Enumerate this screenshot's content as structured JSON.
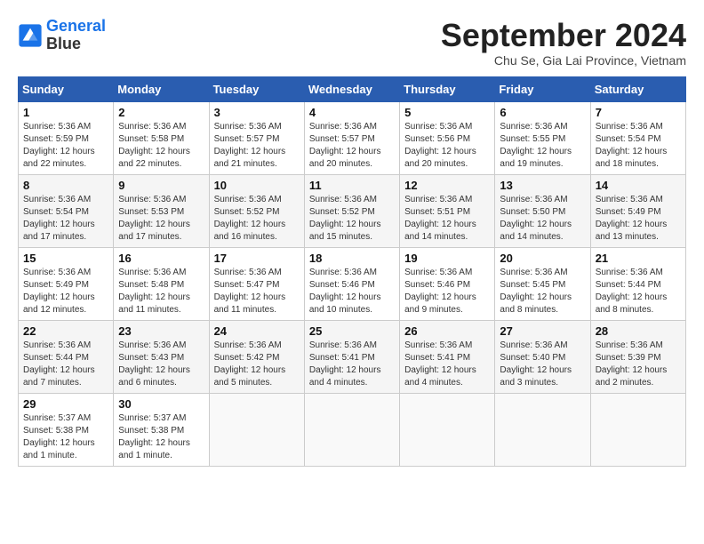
{
  "header": {
    "logo_line1": "General",
    "logo_line2": "Blue",
    "month_title": "September 2024",
    "subtitle": "Chu Se, Gia Lai Province, Vietnam"
  },
  "weekdays": [
    "Sunday",
    "Monday",
    "Tuesday",
    "Wednesday",
    "Thursday",
    "Friday",
    "Saturday"
  ],
  "weeks": [
    [
      {
        "day": "1",
        "sunrise": "5:36 AM",
        "sunset": "5:59 PM",
        "daylight": "12 hours and 22 minutes."
      },
      {
        "day": "2",
        "sunrise": "5:36 AM",
        "sunset": "5:58 PM",
        "daylight": "12 hours and 22 minutes."
      },
      {
        "day": "3",
        "sunrise": "5:36 AM",
        "sunset": "5:57 PM",
        "daylight": "12 hours and 21 minutes."
      },
      {
        "day": "4",
        "sunrise": "5:36 AM",
        "sunset": "5:57 PM",
        "daylight": "12 hours and 20 minutes."
      },
      {
        "day": "5",
        "sunrise": "5:36 AM",
        "sunset": "5:56 PM",
        "daylight": "12 hours and 20 minutes."
      },
      {
        "day": "6",
        "sunrise": "5:36 AM",
        "sunset": "5:55 PM",
        "daylight": "12 hours and 19 minutes."
      },
      {
        "day": "7",
        "sunrise": "5:36 AM",
        "sunset": "5:54 PM",
        "daylight": "12 hours and 18 minutes."
      }
    ],
    [
      {
        "day": "8",
        "sunrise": "5:36 AM",
        "sunset": "5:54 PM",
        "daylight": "12 hours and 17 minutes."
      },
      {
        "day": "9",
        "sunrise": "5:36 AM",
        "sunset": "5:53 PM",
        "daylight": "12 hours and 17 minutes."
      },
      {
        "day": "10",
        "sunrise": "5:36 AM",
        "sunset": "5:52 PM",
        "daylight": "12 hours and 16 minutes."
      },
      {
        "day": "11",
        "sunrise": "5:36 AM",
        "sunset": "5:52 PM",
        "daylight": "12 hours and 15 minutes."
      },
      {
        "day": "12",
        "sunrise": "5:36 AM",
        "sunset": "5:51 PM",
        "daylight": "12 hours and 14 minutes."
      },
      {
        "day": "13",
        "sunrise": "5:36 AM",
        "sunset": "5:50 PM",
        "daylight": "12 hours and 14 minutes."
      },
      {
        "day": "14",
        "sunrise": "5:36 AM",
        "sunset": "5:49 PM",
        "daylight": "12 hours and 13 minutes."
      }
    ],
    [
      {
        "day": "15",
        "sunrise": "5:36 AM",
        "sunset": "5:49 PM",
        "daylight": "12 hours and 12 minutes."
      },
      {
        "day": "16",
        "sunrise": "5:36 AM",
        "sunset": "5:48 PM",
        "daylight": "12 hours and 11 minutes."
      },
      {
        "day": "17",
        "sunrise": "5:36 AM",
        "sunset": "5:47 PM",
        "daylight": "12 hours and 11 minutes."
      },
      {
        "day": "18",
        "sunrise": "5:36 AM",
        "sunset": "5:46 PM",
        "daylight": "12 hours and 10 minutes."
      },
      {
        "day": "19",
        "sunrise": "5:36 AM",
        "sunset": "5:46 PM",
        "daylight": "12 hours and 9 minutes."
      },
      {
        "day": "20",
        "sunrise": "5:36 AM",
        "sunset": "5:45 PM",
        "daylight": "12 hours and 8 minutes."
      },
      {
        "day": "21",
        "sunrise": "5:36 AM",
        "sunset": "5:44 PM",
        "daylight": "12 hours and 8 minutes."
      }
    ],
    [
      {
        "day": "22",
        "sunrise": "5:36 AM",
        "sunset": "5:44 PM",
        "daylight": "12 hours and 7 minutes."
      },
      {
        "day": "23",
        "sunrise": "5:36 AM",
        "sunset": "5:43 PM",
        "daylight": "12 hours and 6 minutes."
      },
      {
        "day": "24",
        "sunrise": "5:36 AM",
        "sunset": "5:42 PM",
        "daylight": "12 hours and 5 minutes."
      },
      {
        "day": "25",
        "sunrise": "5:36 AM",
        "sunset": "5:41 PM",
        "daylight": "12 hours and 4 minutes."
      },
      {
        "day": "26",
        "sunrise": "5:36 AM",
        "sunset": "5:41 PM",
        "daylight": "12 hours and 4 minutes."
      },
      {
        "day": "27",
        "sunrise": "5:36 AM",
        "sunset": "5:40 PM",
        "daylight": "12 hours and 3 minutes."
      },
      {
        "day": "28",
        "sunrise": "5:36 AM",
        "sunset": "5:39 PM",
        "daylight": "12 hours and 2 minutes."
      }
    ],
    [
      {
        "day": "29",
        "sunrise": "5:37 AM",
        "sunset": "5:38 PM",
        "daylight": "12 hours and 1 minute."
      },
      {
        "day": "30",
        "sunrise": "5:37 AM",
        "sunset": "5:38 PM",
        "daylight": "12 hours and 1 minute."
      },
      null,
      null,
      null,
      null,
      null
    ]
  ]
}
